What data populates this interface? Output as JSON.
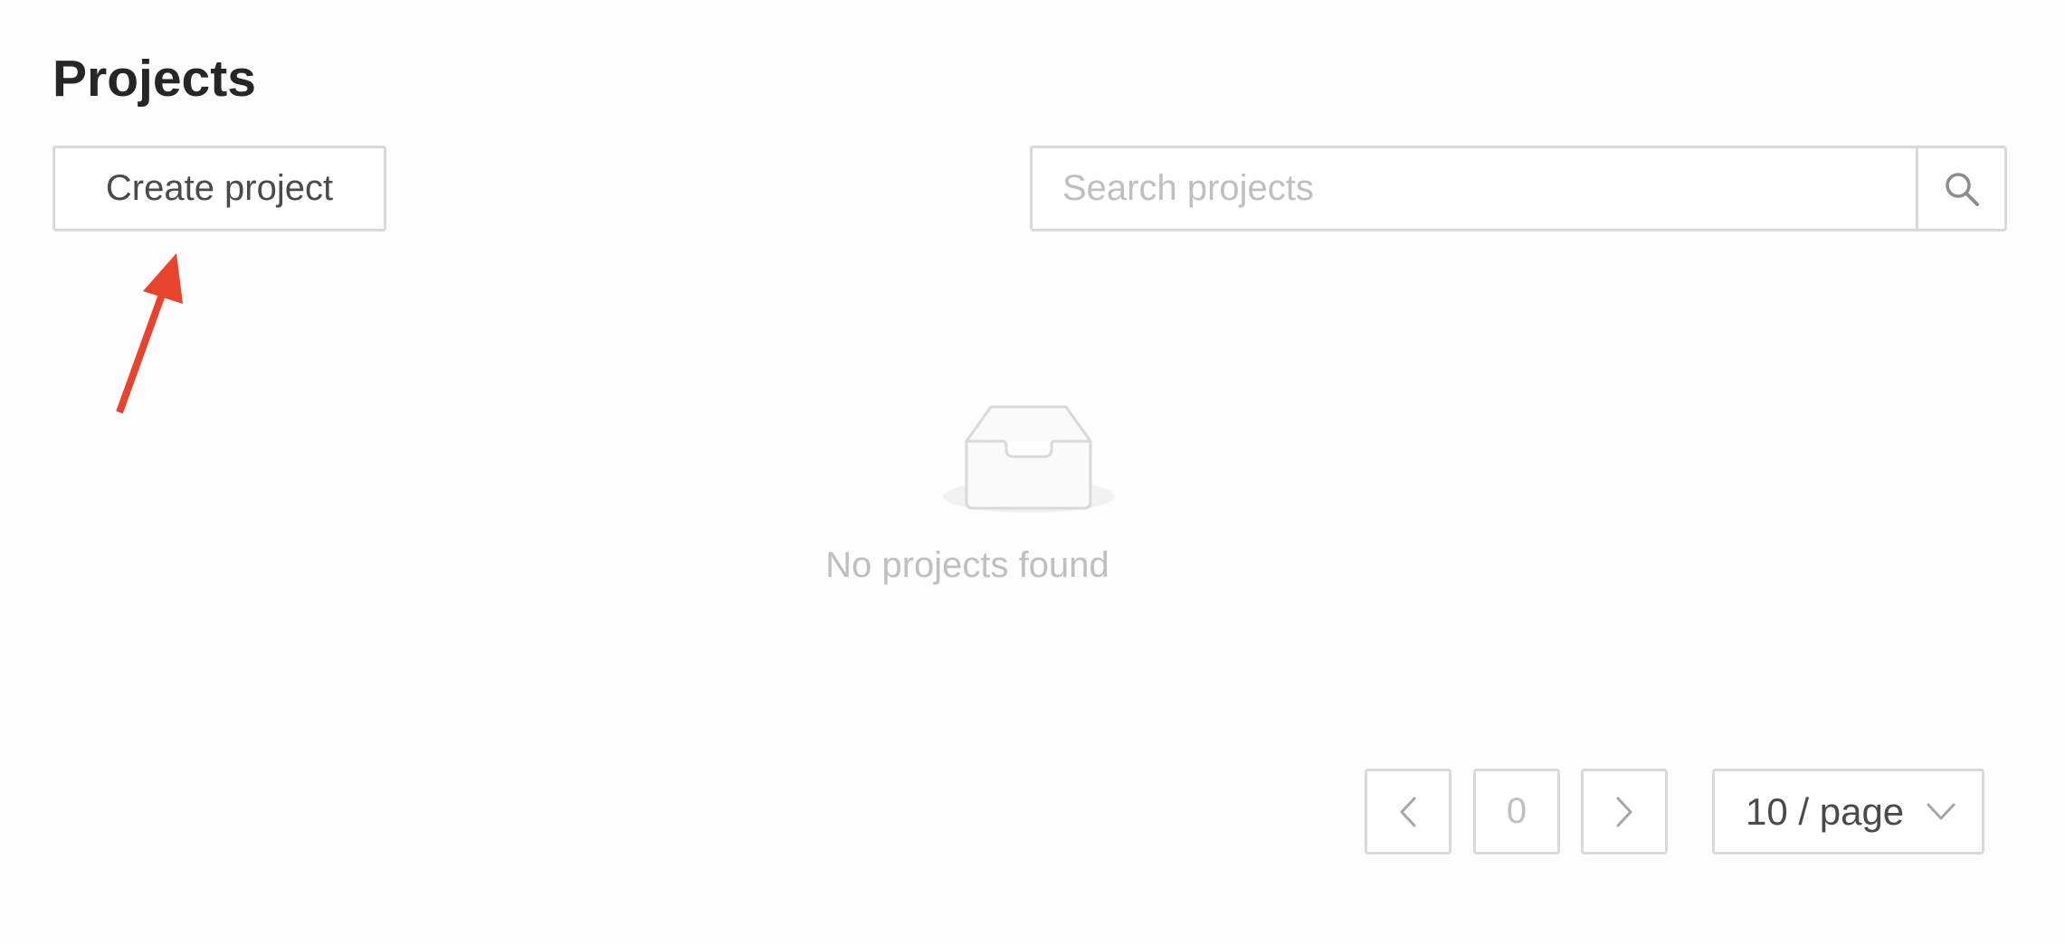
{
  "page": {
    "title": "Projects"
  },
  "toolbar": {
    "create_label": "Create project",
    "search_placeholder": "Search projects",
    "search_value": "",
    "search_icon": "search-icon"
  },
  "annotation": {
    "arrow_color": "#e8432d"
  },
  "empty_state": {
    "icon": "empty-inbox-icon",
    "message": "No projects found"
  },
  "pagination": {
    "prev_icon": "chevron-left-icon",
    "current_page": "0",
    "next_icon": "chevron-right-icon",
    "page_size_label": "10 / page",
    "page_size_icon": "chevron-down-icon"
  }
}
